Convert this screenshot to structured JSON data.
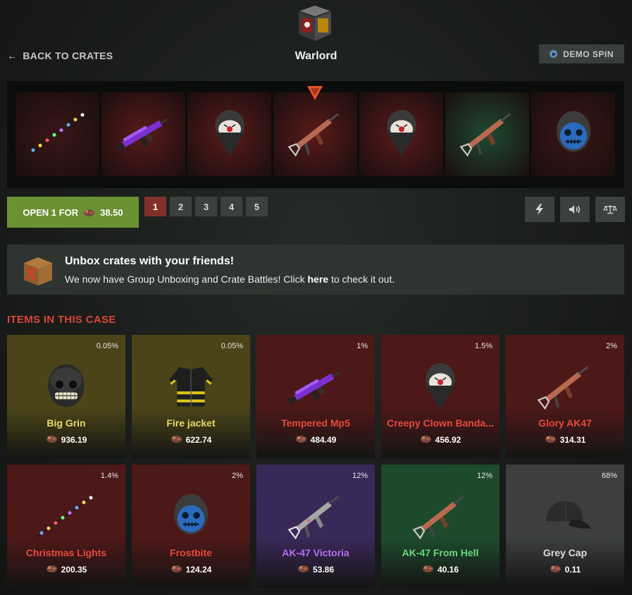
{
  "header": {
    "back_label": "BACK TO CRATES",
    "crate_name": "Warlord",
    "demo_label": "DEMO SPIN"
  },
  "spinner": {
    "items": [
      {
        "icon": "lights-icon",
        "tint": "#3a1616"
      },
      {
        "icon": "mp5-icon",
        "tint": "#5a1a1a"
      },
      {
        "icon": "clown-bandana-icon",
        "tint": "#5a1a1a"
      },
      {
        "icon": "ak47-icon",
        "tint": "#5a1a1a"
      },
      {
        "icon": "clown-bandana-icon",
        "tint": "#5a1a1a"
      },
      {
        "icon": "ak47-icon",
        "tint": "#1f4a30"
      },
      {
        "icon": "skull-mask-icon",
        "tint": "#3a1616"
      }
    ]
  },
  "controls": {
    "open_prefix": "OPEN 1 FOR",
    "open_price": "38.50",
    "quantities": [
      "1",
      "2",
      "3",
      "4",
      "5"
    ],
    "active_quantity": "1"
  },
  "banner": {
    "title": "Unbox crates with your friends!",
    "text_before": "We now have Group Unboxing and Crate Battles! Click",
    "link": "here",
    "text_after": "to check it out."
  },
  "section_title": "ITEMS IN THIS CASE",
  "items": [
    {
      "name": "Big Grin",
      "price": "936.19",
      "chance": "0.05%",
      "rarity_color": "#e8d86a",
      "bg": "#4a4418",
      "icon": "big-grin-icon"
    },
    {
      "name": "Fire jacket",
      "price": "622.74",
      "chance": "0.05%",
      "rarity_color": "#e8d86a",
      "bg": "#4a4418",
      "icon": "fire-jacket-icon"
    },
    {
      "name": "Tempered Mp5",
      "price": "484.49",
      "chance": "1%",
      "rarity_color": "#e64a3f",
      "bg": "#4d1818",
      "icon": "mp5-icon"
    },
    {
      "name": "Creepy Clown Banda...",
      "price": "456.92",
      "chance": "1.5%",
      "rarity_color": "#e64a3f",
      "bg": "#4d1818",
      "icon": "clown-bandana-icon"
    },
    {
      "name": "Glory AK47",
      "price": "314.31",
      "chance": "2%",
      "rarity_color": "#e64a3f",
      "bg": "#4d1818",
      "icon": "ak47-icon"
    },
    {
      "name": "Christmas Lights",
      "price": "200.35",
      "chance": "1.4%",
      "rarity_color": "#e64a3f",
      "bg": "#4d1818",
      "icon": "lights-icon"
    },
    {
      "name": "Frostbite",
      "price": "124.24",
      "chance": "2%",
      "rarity_color": "#e64a3f",
      "bg": "#4d1818",
      "icon": "skull-mask-icon"
    },
    {
      "name": "AK-47 Victoria",
      "price": "53.86",
      "chance": "12%",
      "rarity_color": "#b66df0",
      "bg": "#3a2858",
      "icon": "ak47-victoria-icon"
    },
    {
      "name": "AK-47 From Hell",
      "price": "40.16",
      "chance": "12%",
      "rarity_color": "#6bd880",
      "bg": "#1e4a2c",
      "icon": "ak47-icon"
    },
    {
      "name": "Grey Cap",
      "price": "0.11",
      "chance": "68%",
      "rarity_color": "#dddddd",
      "bg": "#3c3f3e",
      "icon": "cap-icon"
    }
  ]
}
